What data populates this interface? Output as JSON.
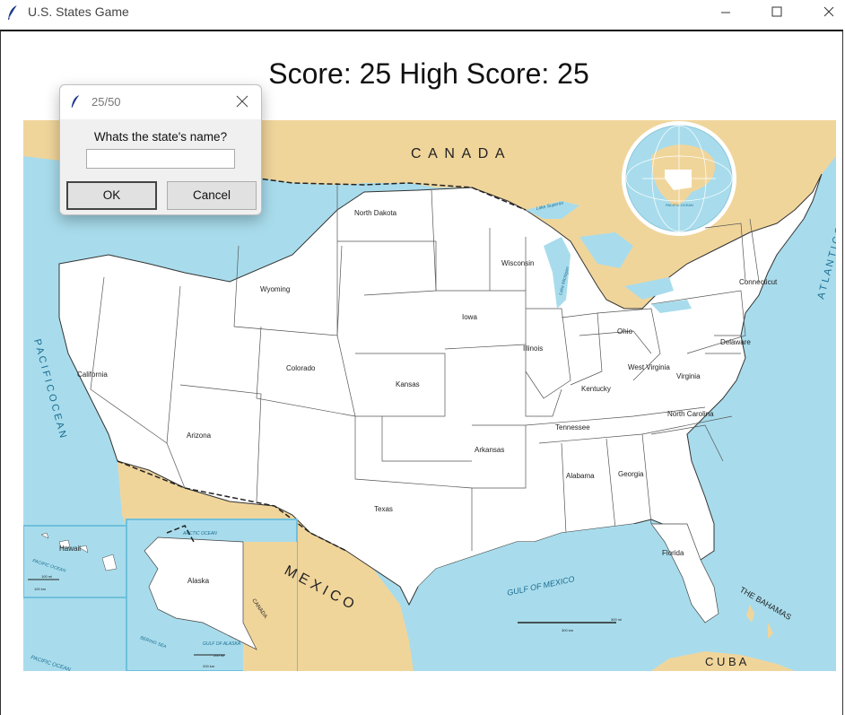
{
  "window": {
    "title": "U.S. States Game",
    "icon": "feather-icon"
  },
  "scoreboard": {
    "text": "Score: 25 High Score: 25"
  },
  "map": {
    "labels": {
      "canada": "C A N A D A",
      "mexico": "M E X I C O",
      "cuba": "C U B A",
      "bahamas": "THE BAHAMAS",
      "pacific": "P A C I F I C   O C E A N",
      "atlantic": "A T L A N T I C   O C E A N",
      "gulf": "GULF OF MEXICO",
      "canada_small": "CANADA",
      "lake_superior": "Lake Superior",
      "lake_michigan": "Lake Michigan",
      "arctic": "ARCTIC OCEAN",
      "gulf_alaska": "GULF OF ALASKA",
      "bering": "BERING SEA",
      "pacific_small": "PACIFIC OCEAN",
      "pacific_inset": "PACIFIC OCEAN",
      "pacific_globe": "PACIFIC OCEAN",
      "scale_mi": "300 mi",
      "scale_km": "300 km",
      "alaska_scale_mi": "200 mi",
      "alaska_scale_km": "200 km",
      "hawaii_scale_mi": "100 mi",
      "hawaii_scale_km": "100 km"
    },
    "guessed_states": [
      "North Dakota",
      "Wyoming",
      "Wisconsin",
      "Iowa",
      "Illinois",
      "Ohio",
      "Connecticut",
      "Delaware",
      "California",
      "Colorado",
      "Kansas",
      "West Virginia",
      "Virginia",
      "Kentucky",
      "North Carolina",
      "Tennessee",
      "Arizona",
      "Arkansas",
      "Alabama",
      "Georgia",
      "Texas",
      "Hawaii",
      "Alaska",
      "Florida"
    ]
  },
  "dialog": {
    "title": "25/50",
    "prompt": "Whats the state's name?",
    "input_value": "",
    "ok_label": "OK",
    "cancel_label": "Cancel"
  },
  "colors": {
    "water": "#a8dcec",
    "foreign_land": "#f0d59b",
    "us_land": "#ffffff",
    "border": "#555555"
  }
}
